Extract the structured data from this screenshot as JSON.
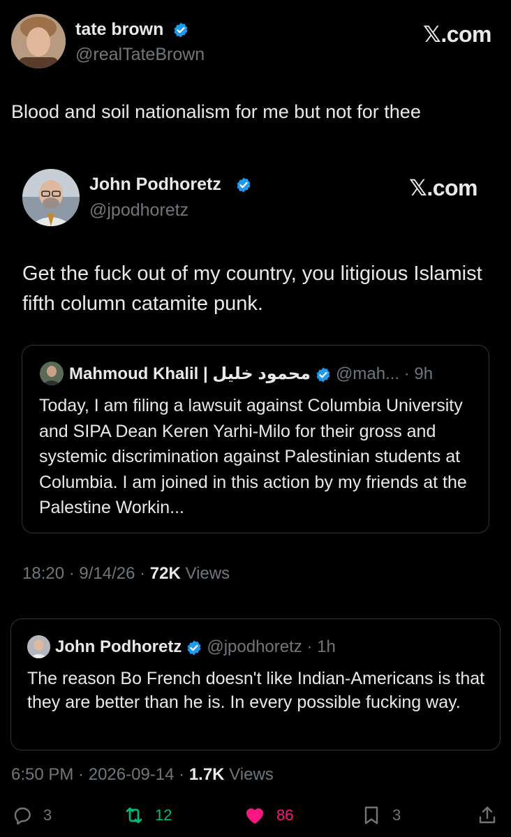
{
  "tweet": {
    "author_name": "tate brown",
    "author_handle": "@realTateBrown",
    "brand": "𝕏.com",
    "text": "Blood and soil nationalism for me but not for thee",
    "time": "6:50 PM",
    "date": "2026-09-14",
    "views_count": "1.7K",
    "views_label": "Views",
    "actions": {
      "replies": "3",
      "retweets": "12",
      "likes": "86",
      "bookmarks": "3"
    },
    "colors": {
      "retweet": "#00ba7c",
      "like": "#f91880",
      "verified": "#1d9bf0"
    }
  },
  "embedded": {
    "author_name": "John Podhoretz",
    "author_handle": "@jpodhoretz",
    "brand": "𝕏.com",
    "text": "Get the fuck out of my country, you litigious Islamist fifth column catamite punk.",
    "time": "18:20",
    "date": "9/14/26",
    "views_count": "72K",
    "views_label": "Views",
    "quote": {
      "author_name": "Mahmoud Khalil | محمود خليل",
      "author_handle": "@mah...",
      "age": "9h",
      "text": "Today, I am filing a lawsuit against Columbia University and SIPA Dean Keren Yarhi-Milo for their gross and systemic discrimination against Palestinian students at Columbia. I am joined in this action by my friends at the Palestine Workin..."
    }
  },
  "quote2": {
    "author_name": "John Podhoretz",
    "author_handle": "@jpodhoretz",
    "age": "1h",
    "text": "The reason Bo French doesn't like Indian-Americans is that they are better than he is. In every possible fucking way."
  }
}
